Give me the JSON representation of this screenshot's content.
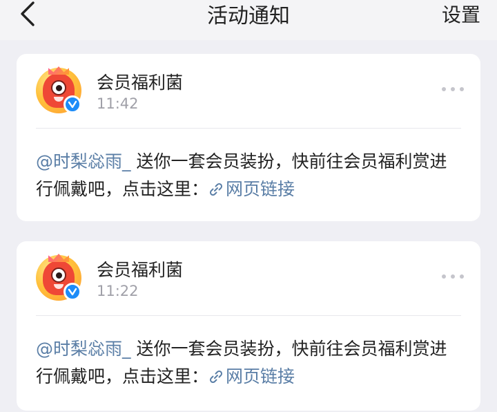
{
  "header": {
    "title": "活动通知",
    "settings_label": "设置"
  },
  "notifications": [
    {
      "sender": "会员福利菌",
      "time": "11:42",
      "mention": "@时梨惢雨_",
      "text": " 送你一套会员装扮，快前往会员福利赏进行佩戴吧，点击这里：",
      "link_label": "网页链接"
    },
    {
      "sender": "会员福利菌",
      "time": "11:22",
      "mention": "@时梨惢雨_",
      "text": " 送你一套会员装扮，快前往会员福利赏进行佩戴吧，点击这里：",
      "link_label": "网页链接"
    }
  ],
  "colors": {
    "background": "#efeff4",
    "card": "#ffffff",
    "link": "#5a7ea6",
    "verified_badge": "#1d8cf8",
    "time_text": "#a0a0a8"
  },
  "icons": [
    "back-arrow-icon",
    "more-dots-icon",
    "verified-badge-icon",
    "link-icon"
  ]
}
